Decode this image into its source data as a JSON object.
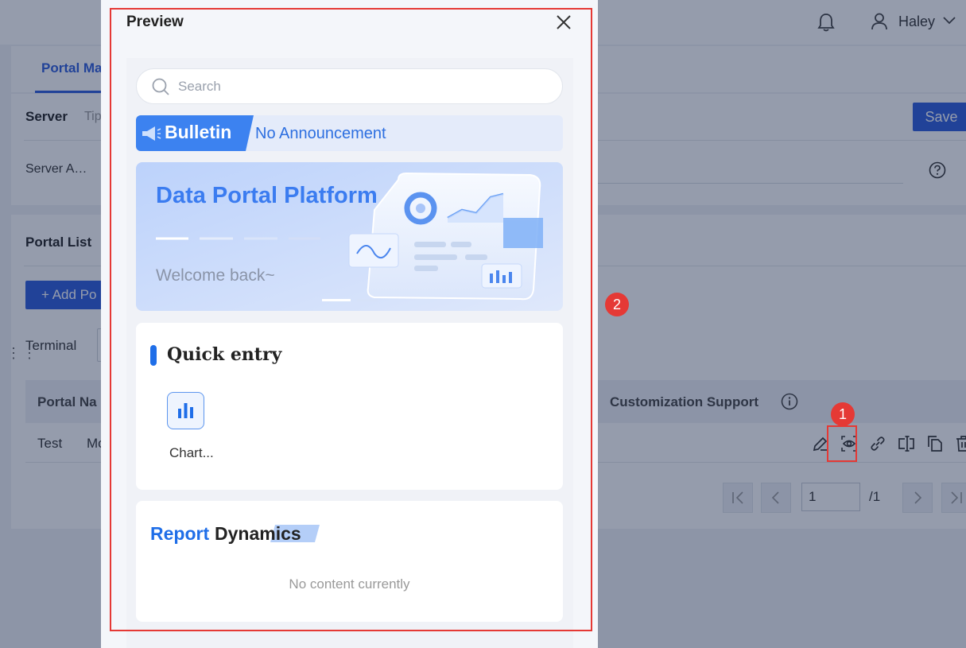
{
  "header": {
    "user_name": "Haley"
  },
  "tabs": {
    "active_label": "Portal Ma"
  },
  "server_card": {
    "title": "Server",
    "tip": "Tip",
    "save_label": "Save",
    "address_label": "Server A…"
  },
  "portal_list": {
    "title": "Portal List",
    "add_label": "+ Add Po",
    "terminal_label": "Terminal",
    "columns": {
      "name": "Portal Na",
      "customization": "Customization Support"
    },
    "rows": [
      {
        "name": "Test",
        "type": "Mo"
      }
    ]
  },
  "pagination": {
    "current": "1",
    "total": "/1"
  },
  "annotations": {
    "badge_1": "1",
    "badge_2": "2",
    "color": "#e53935"
  },
  "modal": {
    "title": "Preview",
    "preview": {
      "search_placeholder": "Search",
      "bulletin_label": "Bulletin",
      "bulletin_text": "No Announcement",
      "banner_title": "Data Portal Platform",
      "banner_subtitle": "Welcome back~",
      "quick_entry_title": "Quick entry",
      "quick_entry_items": [
        {
          "label": "Chart...",
          "icon": "bar-chart-icon"
        }
      ],
      "report_title_part1": "Report",
      "report_title_part2": "Dynamics",
      "report_empty": "No content currently"
    }
  },
  "colors": {
    "primary": "#2d5cdb",
    "accent_blue": "#1f6ee8",
    "highlight_red": "#e53935"
  }
}
